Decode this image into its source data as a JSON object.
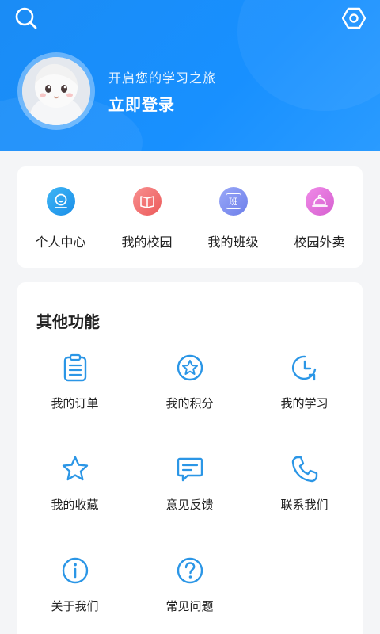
{
  "header": {
    "subtitle": "开启您的学习之旅",
    "login_label": "立即登录"
  },
  "quick_links": [
    {
      "label": "个人中心",
      "icon": "smile-icon",
      "color": "#1a9cf0"
    },
    {
      "label": "我的校园",
      "icon": "book-icon",
      "color": "#f26a6a"
    },
    {
      "label": "我的班级",
      "icon": "class-icon",
      "color": "#7a8cf0",
      "glyph": "班"
    },
    {
      "label": "校园外卖",
      "icon": "food-cover-icon",
      "color": "#e06ad8"
    }
  ],
  "other": {
    "title": "其他功能",
    "items": [
      {
        "label": "我的订单",
        "icon": "order-icon"
      },
      {
        "label": "我的积分",
        "icon": "points-star-icon"
      },
      {
        "label": "我的学习",
        "icon": "history-clock-icon"
      },
      {
        "label": "我的收藏",
        "icon": "star-icon"
      },
      {
        "label": "意见反馈",
        "icon": "message-icon"
      },
      {
        "label": "联系我们",
        "icon": "phone-icon"
      },
      {
        "label": "关于我们",
        "icon": "info-icon"
      },
      {
        "label": "常见问题",
        "icon": "question-icon"
      }
    ]
  },
  "colors": {
    "header_blue": "#1890ff",
    "icon_blue": "#2b96e6"
  }
}
